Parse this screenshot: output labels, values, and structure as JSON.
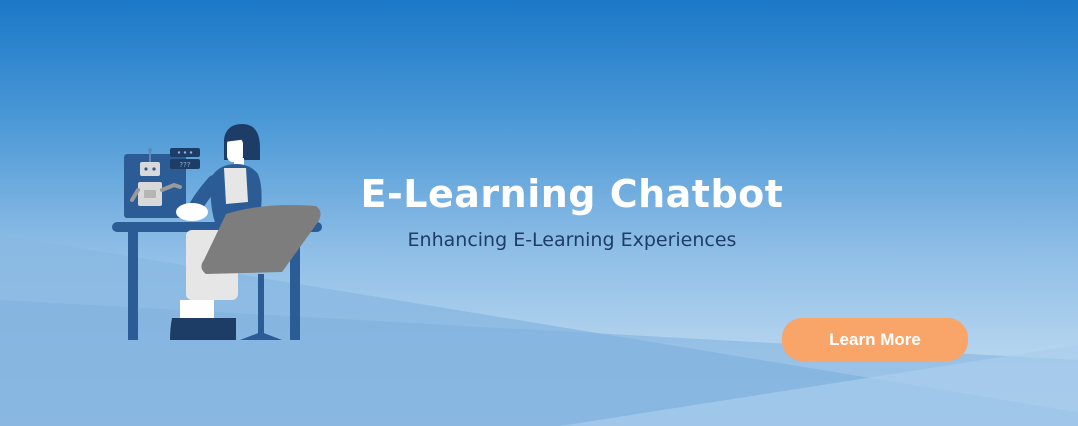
{
  "banner": {
    "title": "E-Learning Chatbot",
    "subtitle": "Enhancing E-Learning Experiences",
    "cta_label": "Learn More",
    "monitor_text": "???",
    "colors": {
      "background_top": "#1b78c8",
      "background_bottom": "#cfe4f4",
      "title": "#ffffff",
      "subtitle": "#1e3d66",
      "cta_background": "#f9a468",
      "cta_text": "#ffffff",
      "figure_navy": "#2b5c96",
      "chair_gray": "#7d7d7d"
    },
    "icons": [
      "person-at-desk-illustration",
      "chatbot-robot-icon",
      "chat-bubble-icon"
    ]
  }
}
